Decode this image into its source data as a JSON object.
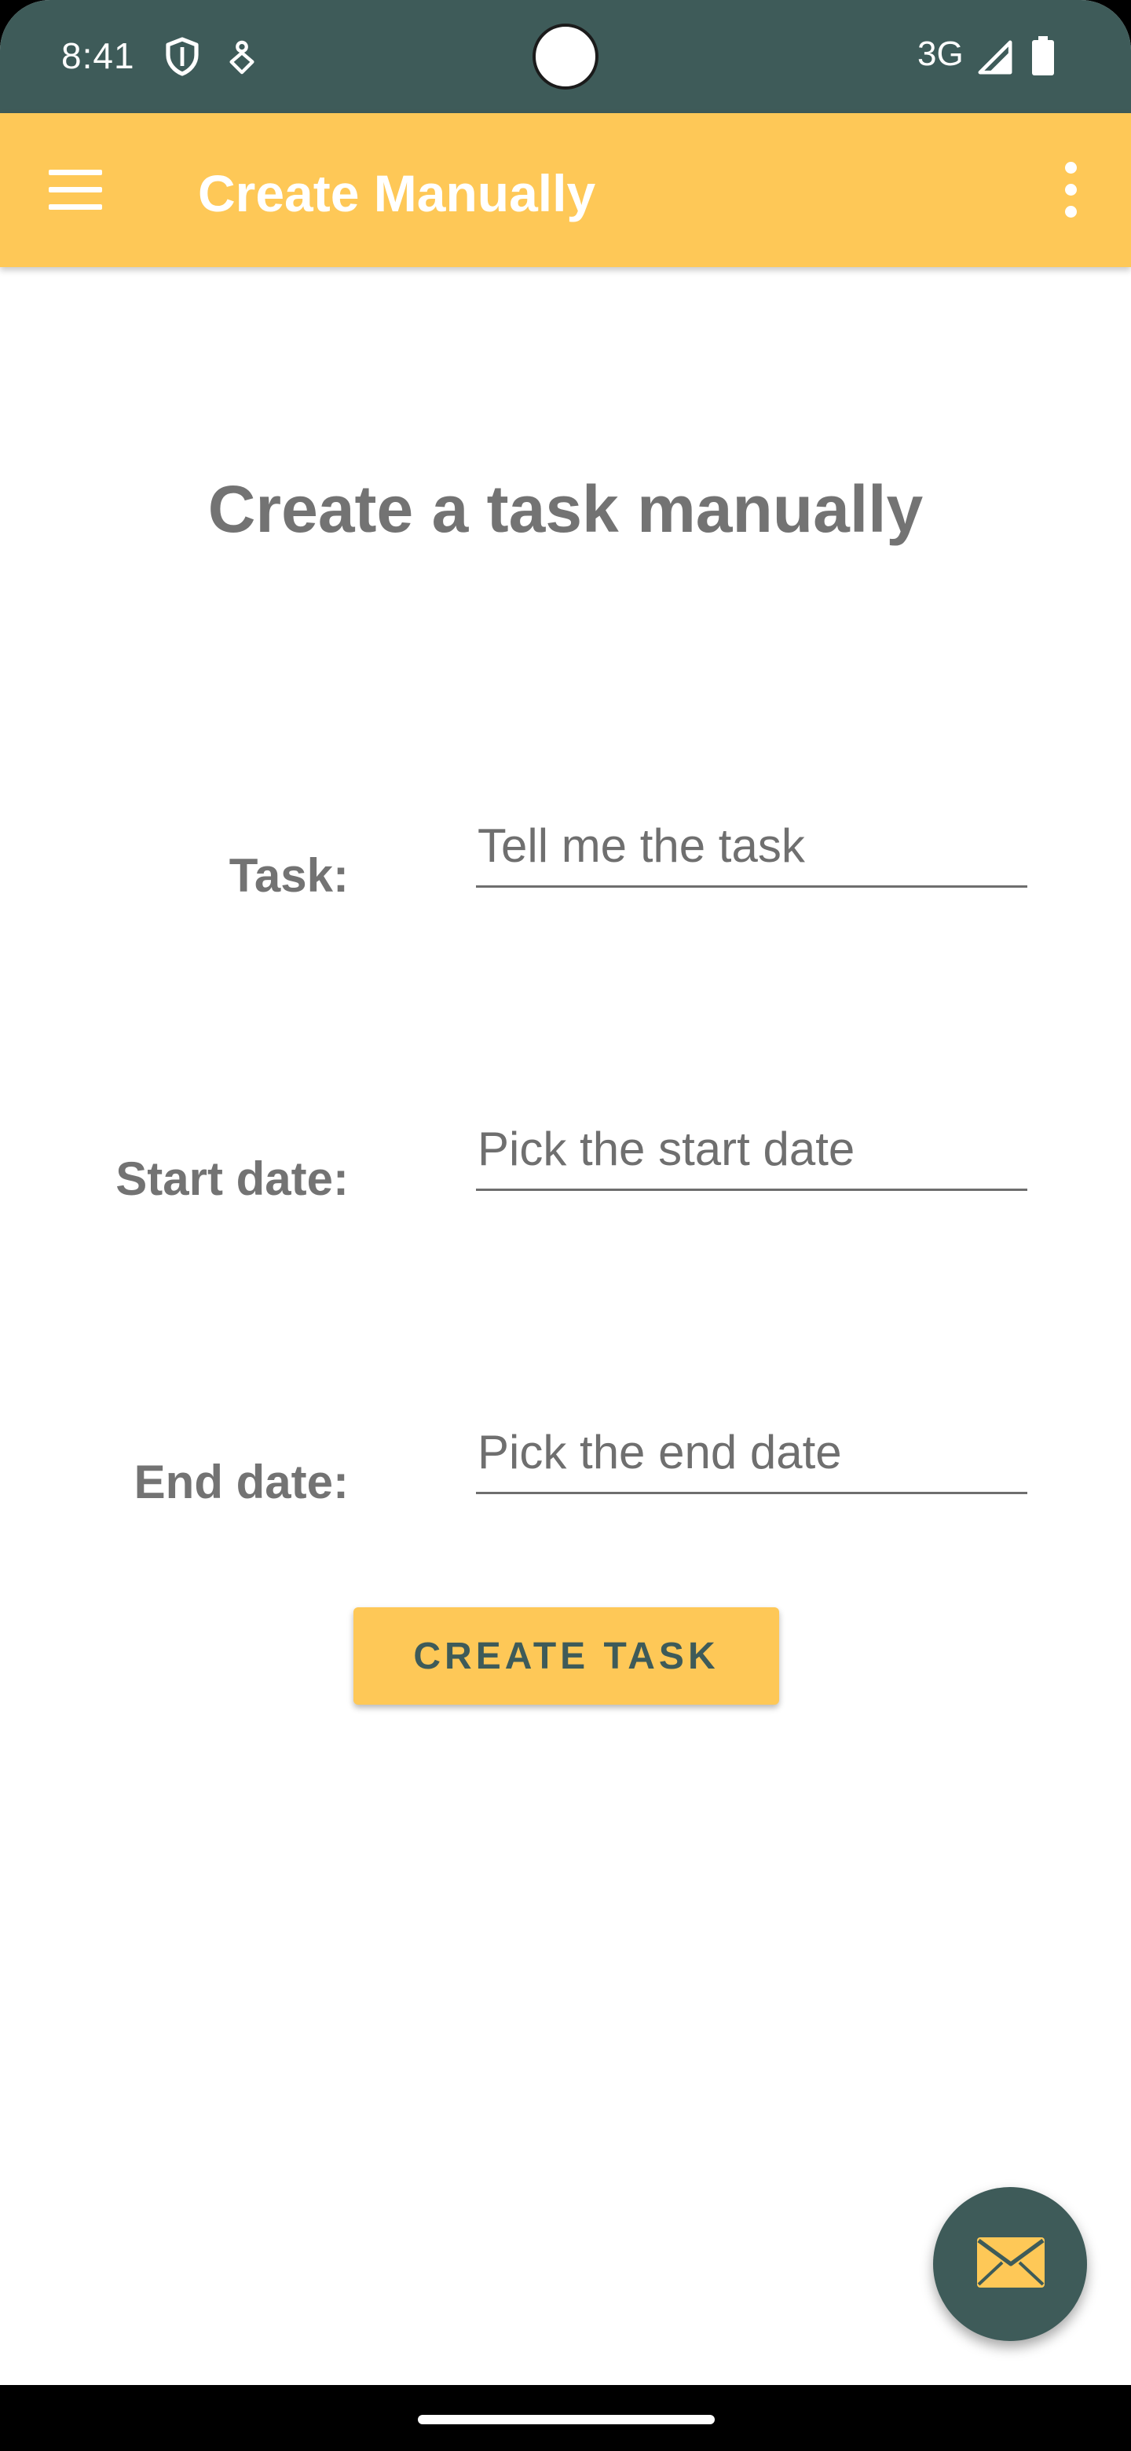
{
  "status_bar": {
    "time": "8:41",
    "network": "3G",
    "icons": [
      "shield-icon",
      "navigation-icon",
      "signal-icon",
      "battery-icon"
    ],
    "background_color": "#3e5b59"
  },
  "app_bar": {
    "title": "Create Manually",
    "menu_icon": "hamburger-menu-icon",
    "overflow_icon": "more-vert-icon",
    "background_color": "#fec857"
  },
  "main": {
    "heading": "Create a task manually",
    "fields": [
      {
        "label": "Task:",
        "placeholder": "Tell me the task",
        "value": ""
      },
      {
        "label": "Start date:",
        "placeholder": "Pick the start date",
        "value": ""
      },
      {
        "label": "End date:",
        "placeholder": "Pick the end date",
        "value": ""
      }
    ],
    "submit_label": "CREATE TASK"
  },
  "fab": {
    "icon": "mail-icon",
    "background_color": "#3e5b59",
    "icon_color": "#fec857"
  }
}
